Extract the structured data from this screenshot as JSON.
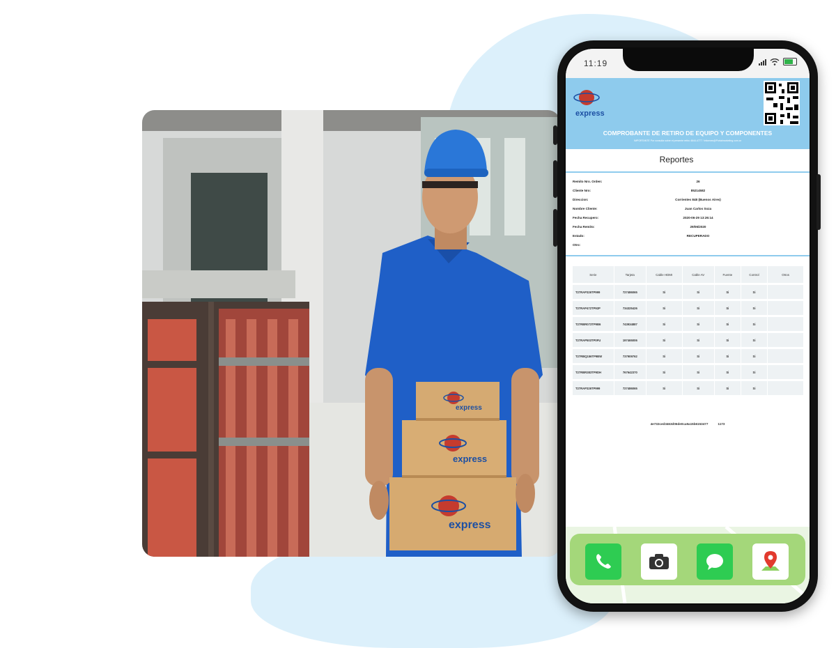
{
  "phone": {
    "time": "11:19",
    "document": {
      "title": "COMPROBANTE DE RETIRO DE EQUIPO Y COMPONENTES",
      "subtitle": "IMPORTANTE Por consulta sobre el presente retiro 4644-4777 / informes@Portalmarketing.com.ar",
      "section": "Reportes",
      "logo_text": "express",
      "fields": [
        {
          "label": "Remito Nro. Orden:",
          "value": "26"
        },
        {
          "label": "Cliente Nro:",
          "value": "85214582"
        },
        {
          "label": "Direccion:",
          "value": "Corrientes 848 (Buenos Aires)"
        },
        {
          "label": "Nombre Cliente:",
          "value": "Juan Carlos Soza"
        },
        {
          "label": "Fecha Recupero:",
          "value": "2020-06-29 13:26:14"
        },
        {
          "label": "Fecha Remito:",
          "value": "29/06/2020"
        },
        {
          "label": "Estado:",
          "value": "RECUPERADO"
        },
        {
          "label": "Otro:",
          "value": ""
        }
      ],
      "table": {
        "headers": [
          "Serie",
          "Tarjeta",
          "Cable HDMI",
          "Cable AV",
          "Fuente",
          "Control",
          "Otros"
        ],
        "rows": [
          [
            "T27RAP326TP999",
            "727486065",
            "Si",
            "Si",
            "Si",
            "Si",
            ""
          ],
          [
            "T27RAP472TP92P",
            "734325426",
            "Si",
            "Si",
            "Si",
            "Si",
            ""
          ],
          [
            "T27RBR073TP9B6",
            "743934887",
            "Si",
            "Si",
            "Si",
            "Si",
            ""
          ],
          [
            "T27RAP503TP0FU",
            "197465006",
            "Si",
            "Si",
            "Si",
            "Si",
            ""
          ],
          [
            "T27RBQ156TP9BW",
            "737909762",
            "Si",
            "Si",
            "Si",
            "Si",
            ""
          ],
          [
            "T27RBR383TP9DH",
            "767642370",
            "Si",
            "Si",
            "Si",
            "Si",
            ""
          ],
          [
            "T27RAP326TP999",
            "727486065",
            "Si",
            "Si",
            "Si",
            "Si",
            ""
          ]
        ]
      },
      "hash": "4e732ced3463d06de0ca9a15b6153477",
      "hash_number": "1173"
    },
    "dock": [
      {
        "name": "phone-app-icon",
        "color": "#2ecc52"
      },
      {
        "name": "camera-app-icon",
        "color": "#ffffff"
      },
      {
        "name": "messages-app-icon",
        "color": "#2ecc52"
      },
      {
        "name": "maps-app-icon",
        "color": "#ffffff"
      }
    ]
  },
  "photo": {
    "box_logo_text": "express"
  },
  "colors": {
    "header_blue": "#8ecbed",
    "blob": "#dcf0fb",
    "shirt_blue": "#1f5fc7"
  }
}
